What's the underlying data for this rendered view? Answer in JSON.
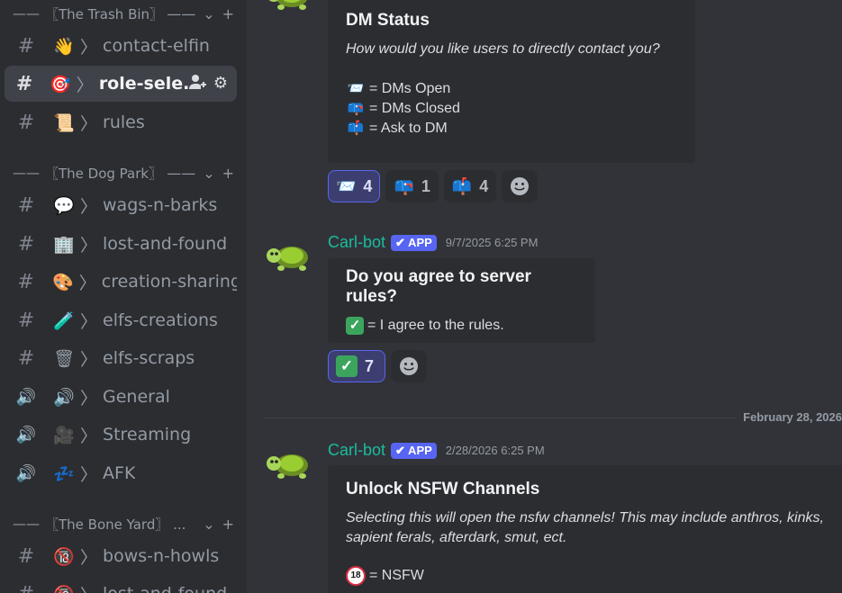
{
  "sidebar": {
    "categories": [
      {
        "label": "〖The Trash Bin〗",
        "dashes": "——",
        "trail": "——"
      },
      {
        "label": "〖The Dog Park〗",
        "dashes": "——",
        "trail": "——"
      },
      {
        "label": "〖The Bone Yard〗 ...",
        "dashes": "——",
        "trail": ""
      }
    ],
    "channels": [
      {
        "emoji": "👋",
        "arrow": "〉",
        "name": "contact-elfin",
        "type": "#"
      },
      {
        "emoji": "🎯",
        "arrow": "〉",
        "name": "role-sele...",
        "type": "#"
      },
      {
        "emoji": "📜",
        "arrow": "〉",
        "name": "rules",
        "type": "#"
      },
      {
        "emoji": "💬",
        "arrow": "〉",
        "name": "wags-n-barks",
        "type": "#"
      },
      {
        "emoji": "🏢",
        "arrow": "〉",
        "name": "lost-and-found",
        "type": "#"
      },
      {
        "emoji": "🎨",
        "arrow": "〉",
        "name": "creation-sharing",
        "type": "#"
      },
      {
        "emoji": "🧪",
        "arrow": "〉",
        "name": "elfs-creations",
        "type": "#"
      },
      {
        "emoji": "🗑",
        "arrow": "〉",
        "name": "elfs-scraps",
        "type": "#"
      },
      {
        "emoji": "🔊",
        "arrow": "〉",
        "name": "General",
        "type": "🔊"
      },
      {
        "emoji": "🎥",
        "arrow": "〉",
        "name": "Streaming",
        "type": "🔊"
      },
      {
        "emoji": "💤",
        "arrow": "〉",
        "name": "AFK",
        "type": "🔊"
      },
      {
        "emoji": "🔞",
        "arrow": "〉",
        "name": "bows-n-howls",
        "type": "#"
      },
      {
        "emoji": "🔞",
        "arrow": "〉",
        "name": "lost-and-found",
        "type": "#"
      }
    ]
  },
  "messages": {
    "dm_embed": {
      "title": "DM Status",
      "description": "How would you like users to directly contact you?",
      "lines": [
        {
          "emoji": "📨",
          "text": "= DMs Open"
        },
        {
          "emoji": "📪",
          "text": "= DMs Closed"
        },
        {
          "emoji": "📫",
          "text": "= Ask to DM"
        }
      ],
      "reactions": [
        {
          "emoji": "📨",
          "count": "4",
          "me": true
        },
        {
          "emoji": "📪",
          "count": "1",
          "me": false
        },
        {
          "emoji": "📫",
          "count": "4",
          "me": false
        }
      ]
    },
    "rules_msg": {
      "author": "Carl-bot",
      "badge": "✔ APP",
      "timestamp": "9/7/2025 6:25 PM",
      "title": "Do you agree to server rules?",
      "line_emoji": "✓",
      "line_text": "= I agree to the rules.",
      "reaction_emoji": "✓",
      "reaction_count": "7"
    },
    "divider_date": "February 28, 2026",
    "nsfw_msg": {
      "author": "Carl-bot",
      "badge": "✔ APP",
      "timestamp": "2/28/2026 6:25 PM",
      "title": "Unlock NSFW Channels",
      "description": "Selecting this will open the nsfw channels! This may include anthros, kinks, sapient ferals, afterdark, smut, ect.",
      "line_emoji": "18",
      "line_text": "= NSFW"
    }
  },
  "colors": {
    "accent": "#5865f2",
    "bot_name": "#1abc9c",
    "sidebar_bg": "#2b2d31",
    "chat_bg": "#323339"
  }
}
